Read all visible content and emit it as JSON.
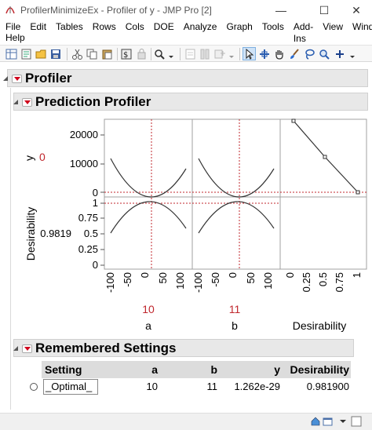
{
  "window": {
    "title": "ProfilerMinimizeEx - Profiler of y - JMP Pro [2]",
    "minimize": "—",
    "maximize": "☐",
    "close": "✕"
  },
  "menu": {
    "row1": [
      "File",
      "Edit",
      "Tables",
      "Rows",
      "Cols",
      "DOE",
      "Analyze",
      "Graph",
      "Tools",
      "Add-Ins",
      "View",
      "Window"
    ],
    "row2": [
      "Help"
    ]
  },
  "toolbar": {
    "icons": [
      "new-data-table-icon",
      "new-script-icon",
      "open-icon",
      "save-icon",
      "cut-icon",
      "copy-icon",
      "paste-icon",
      "journal-icon",
      "layout-icon",
      "search-icon",
      "dropdown-icon",
      "data-icon",
      "columns-icon",
      "add-column-icon",
      "arrow-tool-icon",
      "crosshair-tool-icon",
      "hand-tool-icon",
      "brush-tool-icon",
      "lasso-tool-icon",
      "zoom-tool-icon",
      "plus-tool-icon"
    ]
  },
  "outline": {
    "profiler_title": "Profiler",
    "prediction_title": "Prediction Profiler",
    "remembered_title": "Remembered Settings"
  },
  "profiler": {
    "y_label": "y",
    "y_value": "0",
    "desirability_label": "Desirability",
    "desirability_value": "0.9819",
    "y_ticks": [
      "20000",
      "10000",
      "0"
    ],
    "d_ticks": [
      "1",
      "0.75",
      "0.5",
      "0.25",
      "0"
    ],
    "x_ticks_ab": [
      "-100",
      "-50",
      "0",
      "50",
      "100"
    ],
    "x_ticks_d": [
      "0",
      "0.25",
      "0.5",
      "0.75",
      "1"
    ],
    "factors": [
      {
        "name": "a",
        "value": "10"
      },
      {
        "name": "b",
        "value": "11"
      },
      {
        "name": "Desirability",
        "value": ""
      }
    ],
    "colors": {
      "accent": "#c0272d",
      "curve": "#333333",
      "grid": "#a0a0a0"
    }
  },
  "remembered": {
    "columns": [
      "Setting",
      "a",
      "b",
      "y",
      "Desirability"
    ],
    "rows": [
      {
        "setting": "_Optimal_",
        "a": "10",
        "b": "11",
        "y": "1.262e-29",
        "desirability": "0.981900"
      }
    ]
  }
}
